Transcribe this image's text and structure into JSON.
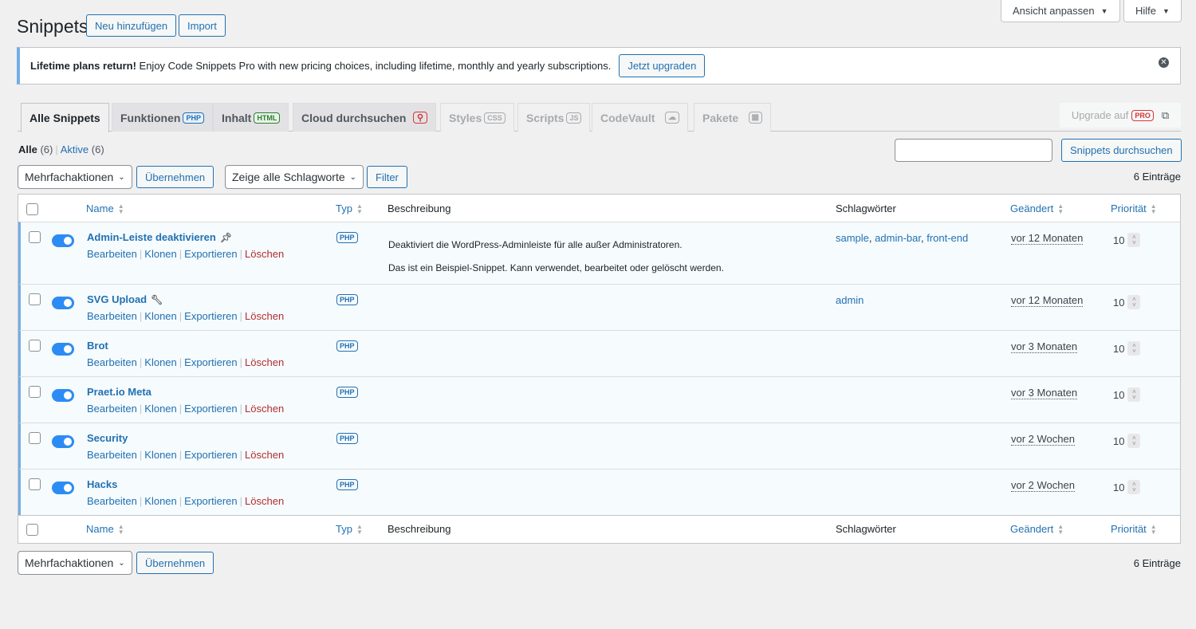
{
  "top": {
    "screen_options": "Ansicht anpassen",
    "help": "Hilfe"
  },
  "header": {
    "title": "Snippets",
    "add_new": "Neu hinzufügen",
    "import": "Import"
  },
  "notice": {
    "bold": "Lifetime plans return!",
    "text": " Enjoy Code Snippets Pro with new pricing choices, including lifetime, monthly and yearly subscriptions.",
    "button": "Jetzt upgraden"
  },
  "tabs": [
    {
      "label": "Alle Snippets"
    },
    {
      "label": "Funktionen",
      "badge": "PHP"
    },
    {
      "label": "Inhalt",
      "badge": "HTML"
    },
    {
      "label": "Cloud durchsuchen"
    },
    {
      "label": "Styles",
      "badge": "CSS"
    },
    {
      "label": "Scripts",
      "badge": "JS"
    },
    {
      "label": "CodeVault"
    },
    {
      "label": "Pakete"
    }
  ],
  "upgrade": {
    "label": "Upgrade auf",
    "badge": "PRO"
  },
  "views": {
    "all": "Alle",
    "all_count": "(6)",
    "active": "Aktive",
    "active_count": "(6)"
  },
  "search": {
    "value": "",
    "button": "Snippets durchsuchen"
  },
  "bulk": {
    "select": "Mehrfachaktionen",
    "apply": "Übernehmen",
    "tag_select": "Zeige alle Schlagworte",
    "filter": "Filter",
    "count": "6 Einträge"
  },
  "columns": {
    "name": "Name",
    "type": "Typ",
    "description": "Beschreibung",
    "tags": "Schlagwörter",
    "modified": "Geändert",
    "priority": "Priorität"
  },
  "actions": {
    "edit": "Bearbeiten",
    "clone": "Klonen",
    "export": "Exportieren",
    "delete": "Löschen"
  },
  "colors": {
    "accent": "#2271b1",
    "delete": "#b32d2e",
    "toggle": "#2c8cf4"
  },
  "rows": [
    {
      "name": "Admin-Leiste deaktivieren",
      "icon": "pin-icon",
      "type": "PHP",
      "active": true,
      "desc": [
        "Deaktiviert die WordPress-Adminleiste für alle außer Administratoren.",
        "Das ist ein Beispiel-Snippet. Kann verwendet, bearbeitet oder gelöscht werden."
      ],
      "tags": [
        "sample",
        "admin-bar",
        "front-end"
      ],
      "modified": "vor 12 Monaten",
      "priority": "10"
    },
    {
      "name": "SVG Upload",
      "icon": "wrench-icon",
      "type": "PHP",
      "active": true,
      "desc": [],
      "tags": [
        "admin"
      ],
      "modified": "vor 12 Monaten",
      "priority": "10"
    },
    {
      "name": "Brot",
      "type": "PHP",
      "active": true,
      "desc": [],
      "tags": [],
      "modified": "vor 3 Monaten",
      "priority": "10"
    },
    {
      "name": "Praet.io Meta",
      "type": "PHP",
      "active": true,
      "desc": [],
      "tags": [],
      "modified": "vor 3 Monaten",
      "priority": "10"
    },
    {
      "name": "Security",
      "type": "PHP",
      "active": true,
      "desc": [],
      "tags": [],
      "modified": "vor 2 Wochen",
      "priority": "10"
    },
    {
      "name": "Hacks",
      "type": "PHP",
      "active": true,
      "desc": [],
      "tags": [],
      "modified": "vor 2 Wochen",
      "priority": "10"
    }
  ]
}
